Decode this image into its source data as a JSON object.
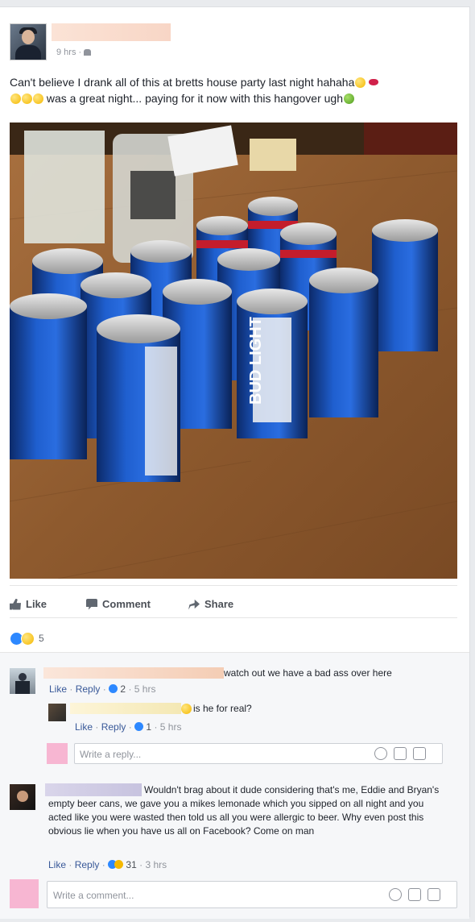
{
  "post": {
    "time": "9 hrs",
    "privacy_icon": "friends-icon",
    "text_line1": "Can't believe I drank all of this at bretts house party last night hahaha",
    "text_line2": "was a great night... paying for it now with this hangover ugh",
    "emoji_names": [
      "grinning-face-icon",
      "lips-icon",
      "laughing-face-icon",
      "nauseated-face-icon"
    ]
  },
  "photo": {
    "can_brand_text": "BUD LIGHT"
  },
  "actions": {
    "like": "Like",
    "comment": "Comment",
    "share": "Share"
  },
  "reactions": {
    "count": "5",
    "types": [
      "like",
      "haha"
    ]
  },
  "comments": [
    {
      "text": "watch out we have a bad ass over here",
      "like": "Like",
      "reply": "Reply",
      "reaction_count": "2",
      "time": "5 hrs"
    },
    {
      "text": "is he for real?",
      "like": "Like",
      "reply": "Reply",
      "reaction_count": "1",
      "time": "5 hrs"
    },
    {
      "text": "Wouldn't brag about it dude considering that's me, Eddie and Bryan's empty beer cans, we gave you a mikes lemonade which you sipped on all night and you acted like you were wasted then told us all you were allergic to beer. Why even post this obvious lie when you have us all on Facebook? Come on man",
      "like": "Like",
      "reply": "Reply",
      "reaction_count": "31",
      "time": "3 hrs"
    }
  ],
  "reply_box": {
    "placeholder": "Write a reply..."
  },
  "comment_box": {
    "placeholder": "Write a comment..."
  },
  "colors": {
    "link": "#385898",
    "like_blue": "#2d88ff",
    "muted": "#90949c"
  }
}
